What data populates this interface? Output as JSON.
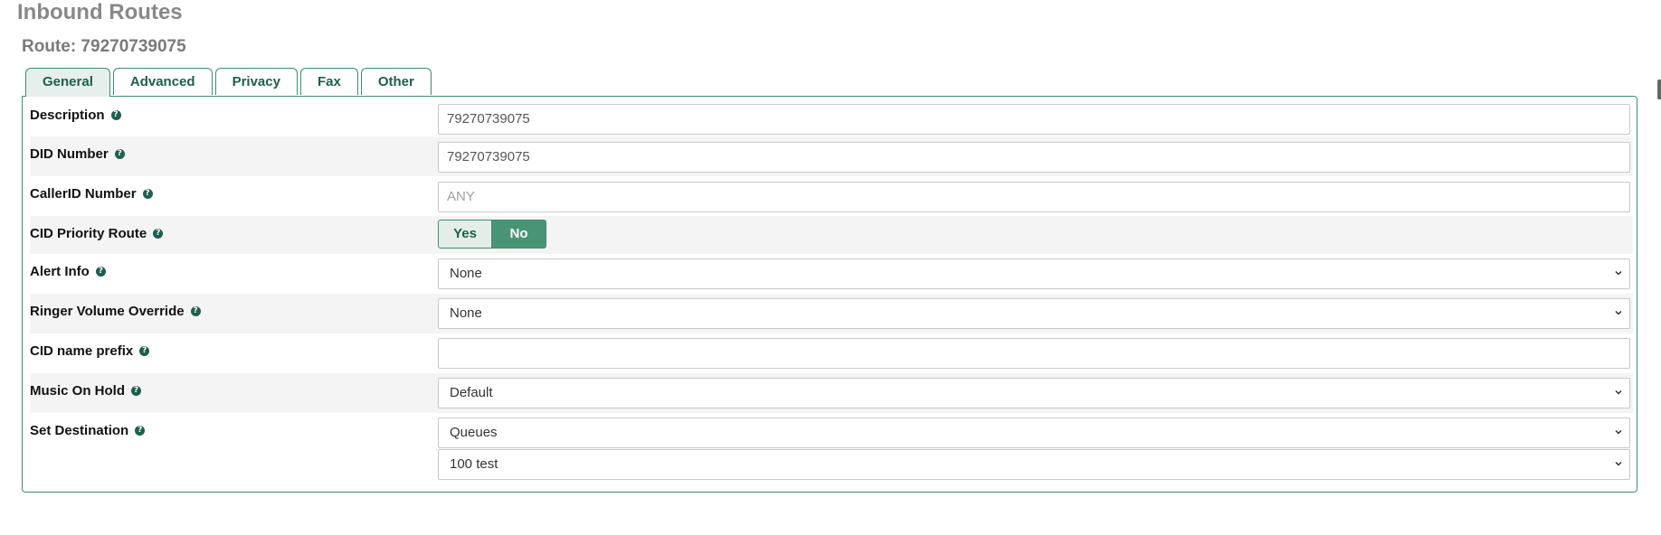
{
  "page_title": "Inbound Routes",
  "route_title": "Route: 79270739075",
  "tabs": [
    {
      "label": "General",
      "active": true
    },
    {
      "label": "Advanced",
      "active": false
    },
    {
      "label": "Privacy",
      "active": false
    },
    {
      "label": "Fax",
      "active": false
    },
    {
      "label": "Other",
      "active": false
    }
  ],
  "form": {
    "description": {
      "label": "Description",
      "value": "79270739075"
    },
    "did_number": {
      "label": "DID Number",
      "value": "79270739075"
    },
    "callerid_number": {
      "label": "CallerID Number",
      "value": "",
      "placeholder": "ANY"
    },
    "cid_priority_route": {
      "label": "CID Priority Route",
      "yes": "Yes",
      "no": "No",
      "selected": "No"
    },
    "alert_info": {
      "label": "Alert Info",
      "value": "None"
    },
    "ringer_volume_override": {
      "label": "Ringer Volume Override",
      "value": "None"
    },
    "cid_name_prefix": {
      "label": "CID name prefix",
      "value": ""
    },
    "music_on_hold": {
      "label": "Music On Hold",
      "value": "Default"
    },
    "set_destination": {
      "label": "Set Destination",
      "type_value": "Queues",
      "target_value": "100 test"
    }
  },
  "help_icon_glyph": "?",
  "colors": {
    "accent": "#3e8c74",
    "accent_dark": "#1f5e4d",
    "toggle_selected": "#4a9476"
  }
}
